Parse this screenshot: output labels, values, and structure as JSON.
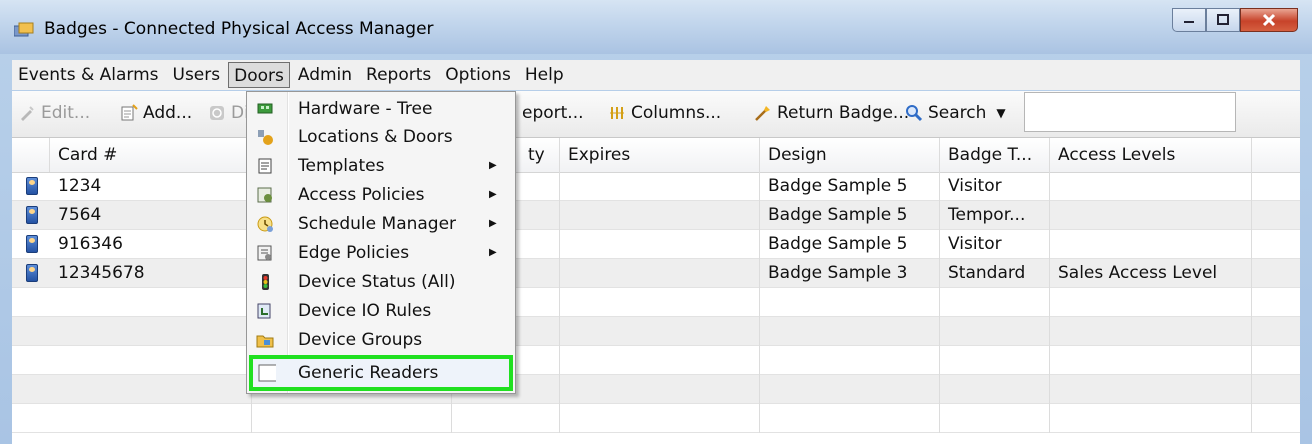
{
  "window": {
    "title": "Badges - Connected Physical Access Manager",
    "controls": [
      "minimize-icon",
      "maximize-icon",
      "close-icon"
    ]
  },
  "menubar": {
    "items": [
      "Events & Alarms",
      "Users",
      "Doors",
      "Admin",
      "Reports",
      "Options",
      "Help"
    ],
    "active": "Doors"
  },
  "toolbar": {
    "edit_label": "Edit...",
    "add_label": "Add...",
    "di_label": "Di",
    "report_label": "eport...",
    "columns_label": "Columns...",
    "return_badge_label": "Return Badge...",
    "search_label": "Search",
    "search_value": ""
  },
  "grid": {
    "columns": [
      "Card #",
      "",
      "ty",
      "Expires",
      "Design",
      "Badge T...",
      "Access Levels"
    ],
    "rows": [
      {
        "card": "1234",
        "design": "Badge Sample 5",
        "badge_type": "Visitor",
        "access_levels": ""
      },
      {
        "card": "7564",
        "design": "Badge Sample 5",
        "badge_type": "Tempor...",
        "access_levels": ""
      },
      {
        "card": "916346",
        "design": "Badge Sample 5",
        "badge_type": "Visitor",
        "access_levels": ""
      },
      {
        "card": "12345678",
        "design": "Badge Sample 3",
        "badge_type": "Standard",
        "access_levels": "Sales Access Level"
      }
    ]
  },
  "doors_menu": {
    "items": [
      {
        "label": "Hardware - Tree",
        "icon": "hardware-tree-icon",
        "submenu": false
      },
      {
        "label": "Locations & Doors",
        "icon": "locations-doors-icon",
        "submenu": false
      },
      {
        "label": "Templates",
        "icon": "templates-icon",
        "submenu": true
      },
      {
        "label": "Access Policies",
        "icon": "access-policies-icon",
        "submenu": true
      },
      {
        "label": "Schedule Manager",
        "icon": "schedule-manager-icon",
        "submenu": true
      },
      {
        "label": "Edge Policies",
        "icon": "edge-policies-icon",
        "submenu": true
      },
      {
        "label": "Device Status (All)",
        "icon": "device-status-icon",
        "submenu": false
      },
      {
        "label": "Device IO Rules",
        "icon": "device-io-rules-icon",
        "submenu": false
      },
      {
        "label": "Device Groups",
        "icon": "device-groups-icon",
        "submenu": false
      },
      {
        "label": "Generic Readers",
        "icon": "generic-readers-icon",
        "submenu": false
      }
    ],
    "highlighted": "Generic Readers",
    "highlight_color": "#20e020"
  }
}
